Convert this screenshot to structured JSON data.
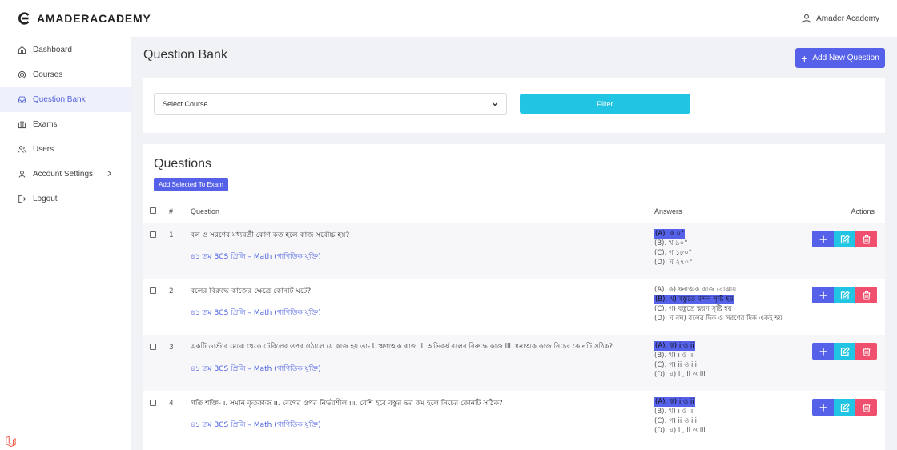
{
  "brand": {
    "name": "AMADERACADEMY"
  },
  "user": {
    "name": "Amader Academy"
  },
  "sidebar": {
    "items": [
      {
        "label": "Dashboard",
        "icon": "home-icon",
        "active": false
      },
      {
        "label": "Courses",
        "icon": "target-icon",
        "active": false
      },
      {
        "label": "Question Bank",
        "icon": "inbox-icon",
        "active": true
      },
      {
        "label": "Exams",
        "icon": "briefcase-icon",
        "active": false
      },
      {
        "label": "Users",
        "icon": "users-icon",
        "active": false
      },
      {
        "label": "Account Settings",
        "icon": "user-icon",
        "active": false,
        "has_chevron": true
      },
      {
        "label": "Logout",
        "icon": "logout-icon",
        "active": false
      }
    ]
  },
  "page": {
    "title": "Question Bank",
    "add_button": "Add New Question"
  },
  "filter": {
    "select_value": "Select Course",
    "button": "Filter"
  },
  "questions_card": {
    "title": "Questions",
    "add_selected_button": "Add Selected To Exam",
    "columns": {
      "num": "#",
      "question": "Question",
      "answers": "Answers",
      "actions": "Actions"
    },
    "rows": [
      {
        "num": "1",
        "question": "বল ও সরণের মধ্যবর্তী কোণ কত হলে কাজ সর্বোচ্চ হয়?",
        "course": "৪১ তম BCS প্রিলি – Math (গাণিতিক যুক্তি)",
        "answers": [
          {
            "text": "(A). ক  ০°",
            "correct": true
          },
          {
            "text": "(B). খ ৯০°",
            "correct": false
          },
          {
            "text": "(C). গ ১৮০°",
            "correct": false
          },
          {
            "text": "(D). ঘ ২৭০°",
            "correct": false
          }
        ]
      },
      {
        "num": "2",
        "question": "বলের বিরুদ্ধে কাজের ক্ষেত্রে কোনটি ঘটে?",
        "course": "৪১ তম BCS প্রিলি – Math (গাণিতিক যুক্তি)",
        "answers": [
          {
            "text": "(A). ক) ধনাত্মক কাজ বোঝায়",
            "correct": false
          },
          {
            "text": "(B). খ) বস্তুতে মন্দন সৃষ্টি হয়",
            "correct": true
          },
          {
            "text": "(C). গ) বস্তুতে ত্বরণ সৃষ্টি হয়",
            "correct": false
          },
          {
            "text": "(D). ঘ বঘ) বলের দিক ও সরণের দিক একই হয়",
            "correct": false
          }
        ]
      },
      {
        "num": "3",
        "question": "একটি ডাস্টার মেঝে থেকে টেবিলের ওপর ওঠালে যে কাজ হয় তা- i. ঋণাত্মক কাজ ii. অভিকর্ষ বলের বিরুদ্ধে কাজ iii. ধনাত্মক কাজ নিচের কোনটি সঠিক?",
        "course": "৪১ তম BCS প্রিলি – Math (গাণিতিক যুক্তি)",
        "answers": [
          {
            "text": "(A). ক) i ও ii",
            "correct": true
          },
          {
            "text": "(B). খ) i ও iii",
            "correct": false
          },
          {
            "text": "(C). গ) ii ও iii",
            "correct": false
          },
          {
            "text": "(D). ঘ) i , ii ও iii",
            "correct": false
          }
        ]
      },
      {
        "num": "4",
        "question": "গতি শক্তি- i. সমান কৃতকাজ ii. বেগের ওপর নির্ভরশীল iii. বেশি হবে বস্তুর ভর কম হলে নিচের কোনটি সঠিক?",
        "course": "৪১ তম BCS প্রিলি – Math (গাণিতিক যুক্তি)",
        "answers": [
          {
            "text": "(A). ক) i ও ii",
            "correct": true
          },
          {
            "text": "(B). খ) i ও iii",
            "correct": false
          },
          {
            "text": "(C). গ) ii ও iii",
            "correct": false
          },
          {
            "text": "(D). ঘ) i , ii ও iii",
            "correct": false
          }
        ]
      }
    ]
  },
  "colors": {
    "primary": "#5561e8",
    "info": "#21c4e3",
    "danger": "#f0506e",
    "active_bg": "#eef0fc"
  }
}
